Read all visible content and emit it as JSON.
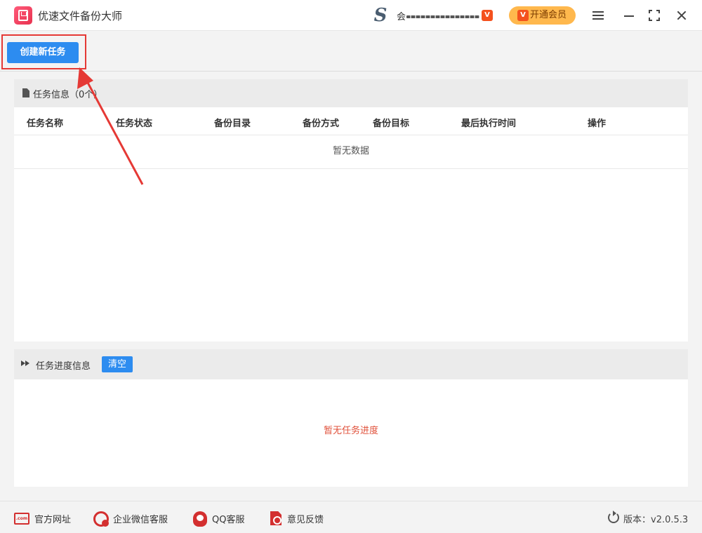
{
  "app": {
    "title": "优速文件备份大师"
  },
  "user": {
    "name_prefix": "会"
  },
  "header": {
    "vip_badge": "V",
    "vip_button_label": "开通会员"
  },
  "toolbar": {
    "create_task_label": "创建新任务"
  },
  "task_panel": {
    "title": "任务信息（0个）",
    "columns": [
      "任务名称",
      "任务状态",
      "备份目录",
      "备份方式",
      "备份目标",
      "最后执行时间",
      "操作"
    ],
    "empty_text": "暂无数据"
  },
  "progress_panel": {
    "title": "任务进度信息",
    "clear_label": "清空",
    "empty_text": "暂无任务进度"
  },
  "footer": {
    "website_label": "官方网址",
    "website_icon_text": ".com",
    "wechat_label": "企业微信客服",
    "qq_label": "QQ客服",
    "feedback_label": "意见反馈",
    "version": "版本：v2.0.5.3"
  },
  "colors": {
    "primary": "#2d8cf0",
    "vip": "#ffb84d",
    "annotation": "#e53935",
    "empty_progress": "#e0503a",
    "footer_icons": "#d32f2f"
  }
}
